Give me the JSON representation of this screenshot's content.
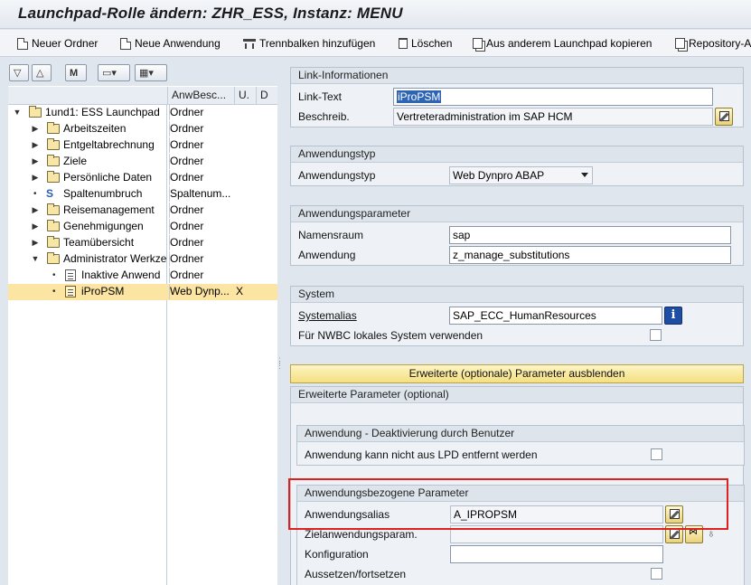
{
  "window": {
    "title": "Launchpad-Rolle ändern: ZHR_ESS, Instanz: MENU"
  },
  "toolbar": {
    "new_folder": "Neuer Ordner",
    "new_app": "Neue Anwendung",
    "add_separator": "Trennbalken hinzufügen",
    "delete": "Löschen",
    "copy_from_launchpad": "Aus anderem Launchpad kopieren",
    "repository": "Repository-A"
  },
  "left_tools": {
    "find_glyph": "M"
  },
  "tree": {
    "headers": {
      "col2": "AnwBesc...",
      "col3": "U.",
      "col4": "D"
    },
    "rows": [
      {
        "label": "1und1: ESS Launchpad",
        "type": "Ordner",
        "flag": ""
      },
      {
        "label": "Arbeitszeiten",
        "type": "Ordner",
        "flag": ""
      },
      {
        "label": "Entgeltabrechnung",
        "type": "Ordner",
        "flag": ""
      },
      {
        "label": "Ziele",
        "type": "Ordner",
        "flag": ""
      },
      {
        "label": "Persönliche Daten",
        "type": "Ordner",
        "flag": ""
      },
      {
        "label": "Spaltenumbruch",
        "type": "Spaltenum...",
        "flag": ""
      },
      {
        "label": "Reisemanagement",
        "type": "Ordner",
        "flag": ""
      },
      {
        "label": "Genehmigungen",
        "type": "Ordner",
        "flag": ""
      },
      {
        "label": "Teamübersicht",
        "type": "Ordner",
        "flag": ""
      },
      {
        "label": "Administrator Werkze",
        "type": "Ordner",
        "flag": ""
      },
      {
        "label": "Inaktive Anwend",
        "type": "Ordner",
        "flag": ""
      },
      {
        "label": "iProPSM",
        "type": "Web Dynp...",
        "flag": "X"
      }
    ]
  },
  "link_info": {
    "header": "Link-Informationen",
    "link_text_label": "Link-Text",
    "link_text_value": "iProPSM",
    "desc_label": "Beschreib.",
    "desc_value": "Vertreteradministration im SAP HCM"
  },
  "app_type": {
    "header": "Anwendungstyp",
    "label": "Anwendungstyp",
    "value": "Web Dynpro ABAP"
  },
  "app_params": {
    "header": "Anwendungsparameter",
    "namespace_label": "Namensraum",
    "namespace_value": "sap",
    "app_label": "Anwendung",
    "app_value": "z_manage_substitutions"
  },
  "system": {
    "header": "System",
    "alias_label": "Systemalias",
    "alias_value": "SAP_ECC_HumanResources",
    "info_glyph": "i",
    "nwbc_label": "Für NWBC lokales System verwenden"
  },
  "advanced_toggle": "Erweiterte (optionale) Parameter ausblenden",
  "advanced": {
    "header": "Erweiterte Parameter (optional)",
    "deact_header": "Anwendung - Deaktivierung durch Benutzer",
    "deact_label": "Anwendung kann nicht aus LPD entfernt werden",
    "appspec_header": "Anwendungsbezogene Parameter",
    "alias_label": "Anwendungsalias",
    "alias_value": "A_IPROPSM",
    "target_label": "Zielanwendungsparam.",
    "target_value": "",
    "config_label": "Konfiguration",
    "config_value": "",
    "suspend_label": "Aussetzen/fortsetzen"
  },
  "colors": {
    "highlight": "#2e64b4",
    "selected_row": "#fce4a3",
    "accent_box": "#e01f1f"
  }
}
